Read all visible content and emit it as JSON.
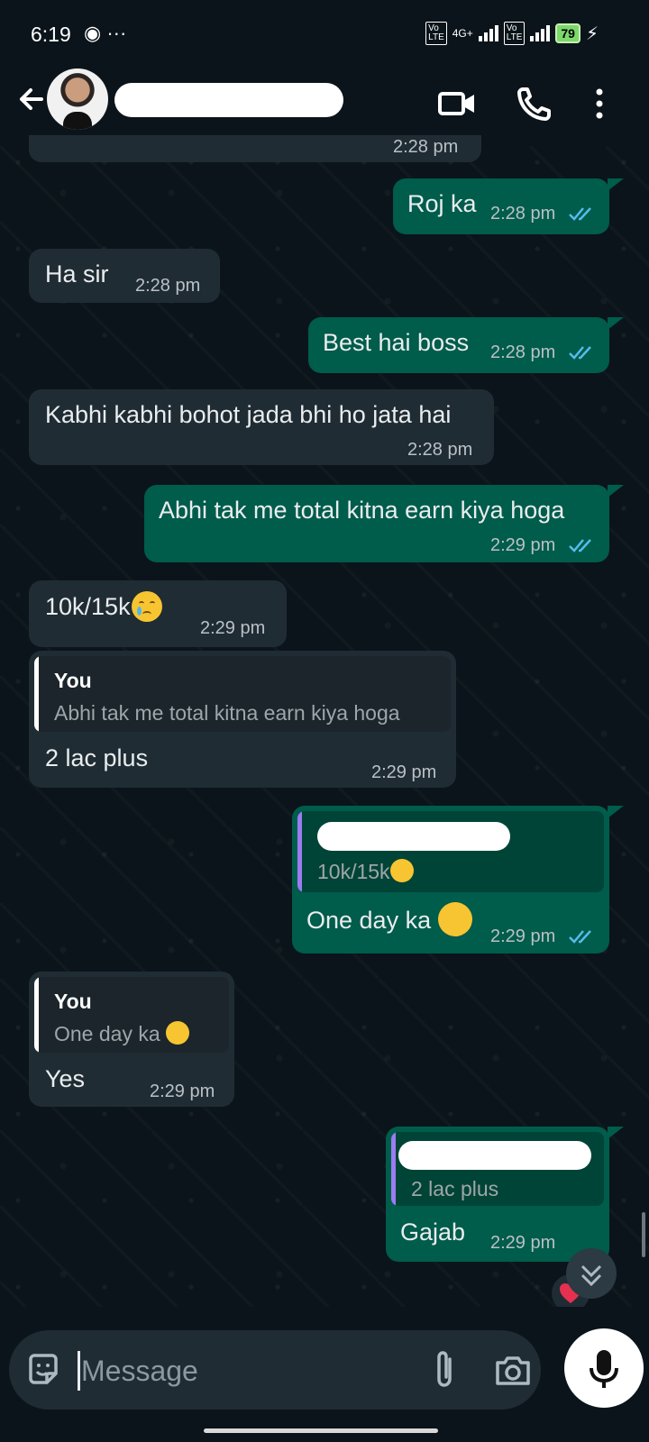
{
  "status_bar": {
    "time": "6:19",
    "left_icons": [
      "whatsapp-icon",
      "more-dots-icon"
    ],
    "right_icons": [
      "volte-icon",
      "4g-plus-icon",
      "signal-icon",
      "volte-icon",
      "signal-icon",
      "battery-icon",
      "charging-icon"
    ],
    "network": "4G+",
    "battery_percent": "79"
  },
  "header": {
    "back_icon": "arrow-left-icon",
    "avatar_icon": "profile-photo",
    "name_redacted": true,
    "video_call_icon": "video-camera-icon",
    "voice_call_icon": "phone-icon",
    "menu_icon": "more-vertical-icon"
  },
  "messages": [
    {
      "direction": "in",
      "partial": true,
      "time": "2:28 pm"
    },
    {
      "direction": "out",
      "text": "Roj ka",
      "time": "2:28 pm",
      "read": true
    },
    {
      "direction": "in",
      "text": "Ha sir",
      "time": "2:28 pm"
    },
    {
      "direction": "out",
      "text": "Best hai boss",
      "time": "2:28 pm",
      "read": true
    },
    {
      "direction": "in",
      "text": "Kabhi kabhi bohot jada bhi ho jata hai",
      "time": "2:28 pm"
    },
    {
      "direction": "out",
      "text": "Abhi tak me total kitna earn kiya hoga",
      "time": "2:29 pm",
      "read": true
    },
    {
      "direction": "in",
      "text": "10k/15k",
      "emoji": "crying-face-emoji",
      "time": "2:29 pm"
    },
    {
      "direction": "in",
      "quote_author": "You",
      "quote_text": "Abhi tak me total kitna earn kiya hoga",
      "text": "2 lac plus",
      "time": "2:29 pm"
    },
    {
      "direction": "out",
      "quote_author_redacted": true,
      "quote_text": "10k/15k",
      "quote_emoji": "crying-face-emoji",
      "text": "One day ka",
      "emoji": "smiling-face-emoji",
      "time": "2:29 pm",
      "read": true
    },
    {
      "direction": "in",
      "quote_author": "You",
      "quote_text": "One day ka",
      "quote_emoji": "smiling-face-emoji",
      "text": "Yes",
      "time": "2:29 pm"
    },
    {
      "direction": "out",
      "quote_author_redacted": true,
      "quote_text": "2 lac plus",
      "text": "Gajab",
      "time": "2:29 pm",
      "reaction": "heart-emoji"
    }
  ],
  "composer": {
    "placeholder": "Message",
    "value": "",
    "emoji_icon": "sticker-smiley-icon",
    "attach_icon": "paperclip-icon",
    "camera_icon": "camera-icon",
    "mic_icon": "microphone-icon"
  },
  "floating": {
    "scroll_icon": "double-chevron-down-icon",
    "reaction_icon": "heart-emoji"
  },
  "colors": {
    "background": "#0b141a",
    "incoming_bubble": "#202c33",
    "outgoing_bubble": "#005c4b",
    "read_ticks": "#53bdeb",
    "quote_bar_in": "#ffffff",
    "quote_bar_out": "#9b7cf1"
  }
}
